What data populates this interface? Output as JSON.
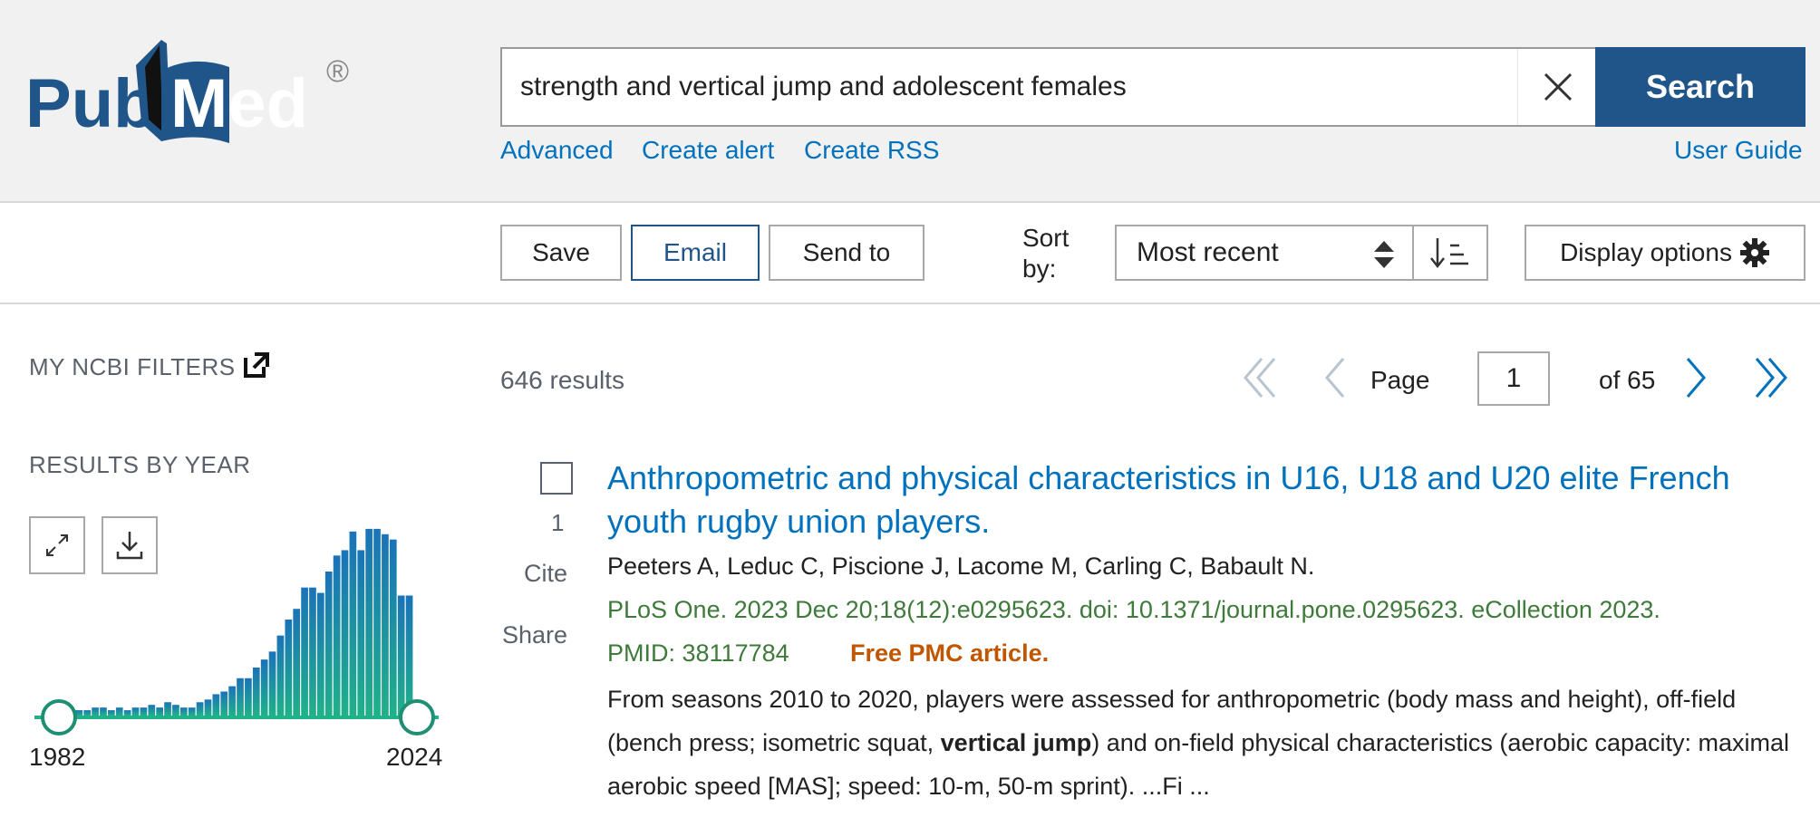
{
  "brand": {
    "name_part1": "Pub",
    "name_part2": "Med",
    "registered": "®",
    "color": "#20558a"
  },
  "search": {
    "query": "strength and vertical jump and adolescent females",
    "button_label": "Search",
    "links": {
      "advanced": "Advanced",
      "create_alert": "Create alert",
      "create_rss": "Create RSS",
      "user_guide": "User Guide"
    }
  },
  "toolbar": {
    "save_label": "Save",
    "email_label": "Email",
    "send_to_label": "Send to",
    "sort_label": "Sort by:",
    "sort_value": "Most recent",
    "display_options_label": "Display options"
  },
  "sidebar": {
    "my_ncbi_filters": "MY NCBI FILTERS",
    "results_by_year": "RESULTS BY YEAR",
    "year_start": "1982",
    "year_end": "2024"
  },
  "chart_data": {
    "type": "bar",
    "title": "",
    "xlabel": "",
    "ylabel": "",
    "x": [
      1982,
      1983,
      1984,
      1985,
      1986,
      1987,
      1988,
      1989,
      1990,
      1991,
      1992,
      1993,
      1994,
      1995,
      1996,
      1997,
      1998,
      1999,
      2000,
      2001,
      2002,
      2003,
      2004,
      2005,
      2006,
      2007,
      2008,
      2009,
      2010,
      2011,
      2012,
      2013,
      2014,
      2015,
      2016,
      2017,
      2018,
      2019,
      2020,
      2021,
      2022,
      2023,
      2024
    ],
    "values": [
      2,
      2,
      2,
      3,
      3,
      2,
      3,
      2,
      3,
      3,
      4,
      3,
      5,
      4,
      3,
      3,
      5,
      6,
      8,
      9,
      11,
      14,
      14,
      18,
      21,
      24,
      30,
      36,
      40,
      48,
      48,
      46,
      54,
      60,
      62,
      69,
      62,
      70,
      70,
      68,
      66,
      45,
      45
    ],
    "ylim": [
      0,
      72
    ],
    "grid": false,
    "colors": [
      "#20b08a",
      "#1a73b8"
    ]
  },
  "results": {
    "count_text": "646 results",
    "page_label": "Page",
    "page_value": "1",
    "page_total": "of 65"
  },
  "article": {
    "number": "1",
    "cite_label": "Cite",
    "share_label": "Share",
    "title": "Anthropometric and physical characteristics in U16, U18 and U20 elite French youth rugby union players.",
    "authors": "Peeters A, Leduc C, Piscione J, Lacome M, Carling C, Babault N.",
    "citation": "PLoS One. 2023 Dec 20;18(12):e0295623. doi: 10.1371/journal.pone.0295623. eCollection 2023.",
    "pmid": "PMID: 38117784",
    "free_label": "Free PMC article.",
    "snippet_before": "From seasons 2010 to 2020, players were assessed for anthropometric (body mass and height), off-field (bench press; isometric squat, ",
    "snippet_highlight": "vertical jump",
    "snippet_after": ") and on-field physical characteristics (aerobic capacity: maximal aerobic speed [MAS]; speed: 10-m, 50-m sprint). ...Fi ..."
  }
}
